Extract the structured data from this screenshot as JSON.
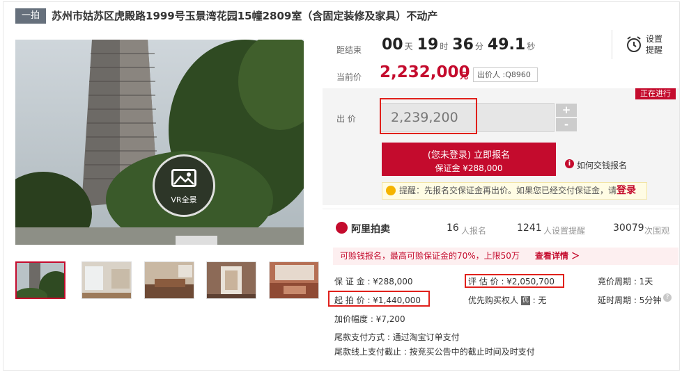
{
  "header": {
    "tag": "一拍",
    "title": "苏州市姑苏区虎殿路1999号玉景湾花园15幢2809室（含固定装修及家具）不动产"
  },
  "gallery": {
    "vr_label": "VR全景",
    "thumbnails_count": 5
  },
  "countdown": {
    "label": "距结束",
    "days": "00",
    "days_unit": "天",
    "hours": "19",
    "hours_unit": "时",
    "minutes": "36",
    "minutes_unit": "分",
    "seconds": "49.1",
    "seconds_unit": "秒",
    "alarm_label": "设置提醒"
  },
  "current": {
    "label": "当前价",
    "price": "2,232,000",
    "unit": "元",
    "bidder": "出价人 :Q8960"
  },
  "bid": {
    "status": "正在进行",
    "label": "出 价",
    "value": "2,239,200",
    "plus": "+",
    "minus": "-",
    "signup_line1": "(您未登录) 立即报名",
    "signup_line2": "保证金 ¥288,000",
    "howto": "如何交钱报名",
    "tip_text": "提醒：先报名交保证金再出价。如果您已经交付保证金，请",
    "tip_login": "登录"
  },
  "stats": {
    "logo": "阿里拍卖",
    "signups": "16",
    "signups_unit": "人报名",
    "reminders": "1241",
    "reminders_unit": "人设置提醒",
    "views": "30079",
    "views_unit": "次围观"
  },
  "promo": {
    "text": "可赊钱报名，最高可赊保证金的70%，上限50万",
    "link": "查看详情 ＞"
  },
  "details": {
    "deposit": "保 证 金 : ¥288,000",
    "appraisal": "评 估 价 : ¥2,050,700",
    "cycle": "竞价周期 : 1天",
    "start": "起 拍 价 : ¥1,440,000",
    "priority_label": "优先购买权人",
    "priority_badge": "优",
    "priority_value": " : 无",
    "delay": "延时周期 : 5分钟",
    "increment": "加价幅度 : ¥7,200",
    "payment": "尾款支付方式 :  通过淘宝订单支付",
    "deadline": "尾款线上支付截止 :  按竞买公告中的截止时间及时支付"
  },
  "colors": {
    "accent": "#c40b2d",
    "highlight_box": "#e0201b"
  }
}
